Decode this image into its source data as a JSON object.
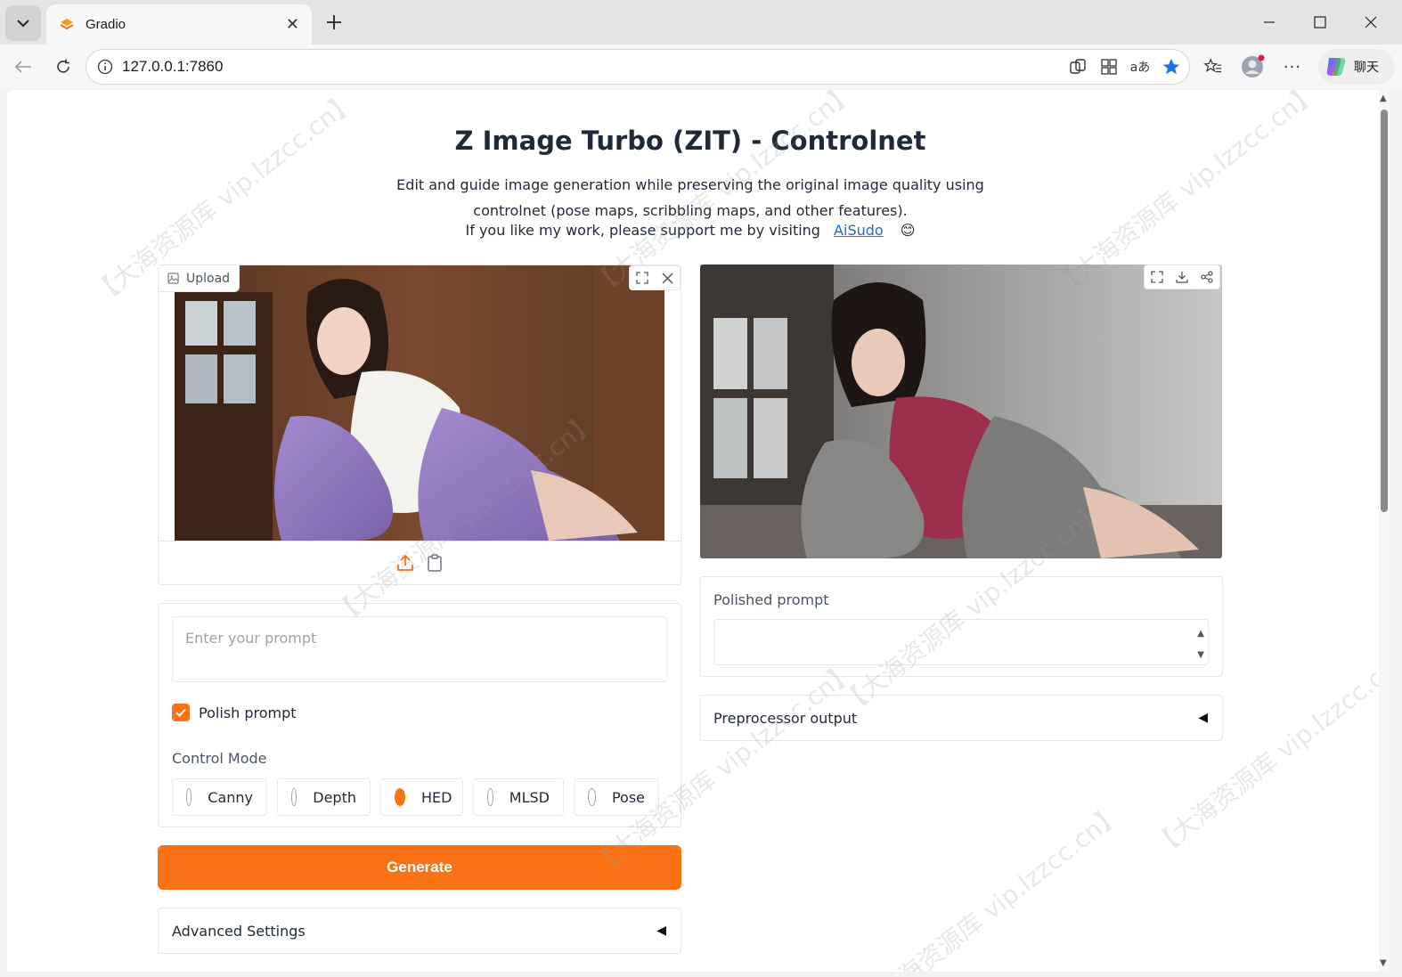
{
  "browser": {
    "tab_title": "Gradio",
    "url": "127.0.0.1:7860",
    "chat_label": "聊天"
  },
  "header": {
    "title": "Z Image Turbo (ZIT) - Controlnet",
    "description": "Edit and guide image generation while preserving the original image quality using controlnet (pose maps, scribbling maps, and other features).",
    "support_text": "If you like my work, please support me by visiting",
    "support_link": "AiSudo",
    "emoji": "😊"
  },
  "input_image": {
    "label": "Upload"
  },
  "prompt": {
    "placeholder": "Enter your prompt",
    "polish_label": "Polish prompt",
    "polish_checked": true
  },
  "control_mode": {
    "label": "Control Mode",
    "options": [
      "Canny",
      "Depth",
      "HED",
      "MLSD",
      "Pose"
    ],
    "selected": "HED"
  },
  "generate_label": "Generate",
  "advanced_settings_label": "Advanced Settings",
  "polished_prompt_label": "Polished prompt",
  "preprocessor_output_label": "Preprocessor output",
  "watermark_text": "【大海资源库 vip.lzzcc.cn】",
  "colors": {
    "accent": "#f97316",
    "link": "#2563eb"
  }
}
